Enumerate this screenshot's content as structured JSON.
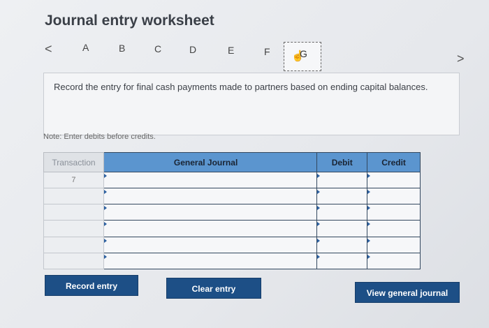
{
  "header": {
    "title": "Journal entry worksheet"
  },
  "nav": {
    "prev_glyph": "<",
    "next_glyph": ">",
    "tabs": [
      "A",
      "B",
      "C",
      "D",
      "E",
      "F"
    ],
    "active_tab": "G",
    "active_icon": "pointer-hand-icon"
  },
  "instruction": {
    "text": "Record the entry for final cash payments made to partners based on ending capital balances."
  },
  "note": "Note: Enter debits before credits.",
  "table": {
    "headers": {
      "transaction": "Transaction",
      "general_journal": "General Journal",
      "debit": "Debit",
      "credit": "Credit"
    },
    "rows": [
      {
        "transaction": "7"
      },
      {
        "transaction": ""
      },
      {
        "transaction": ""
      },
      {
        "transaction": ""
      },
      {
        "transaction": ""
      },
      {
        "transaction": ""
      }
    ]
  },
  "buttons": {
    "record": "Record entry",
    "clear": "Clear entry",
    "view": "View general journal"
  },
  "colors": {
    "header_blue": "#5b95cf",
    "button_navy": "#1d4f86"
  }
}
